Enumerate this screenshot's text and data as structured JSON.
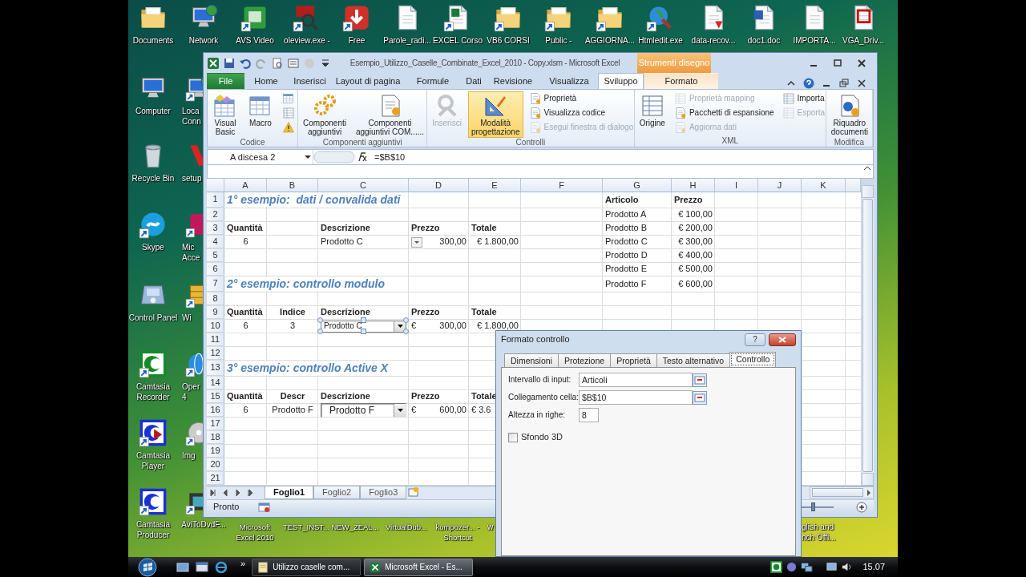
{
  "desktop": {
    "top_row": [
      {
        "label": "Documents",
        "kind": "folder",
        "shortcut": false
      },
      {
        "label": "Network",
        "kind": "network",
        "shortcut": false
      },
      {
        "label": "AVS Video",
        "kind": "video",
        "shortcut": true
      },
      {
        "label": "oleview.exe -",
        "kind": "magnifier",
        "shortcut": true
      },
      {
        "label": "Free",
        "kind": "download",
        "shortcut": true
      },
      {
        "label": "Parole_radi...",
        "kind": "document",
        "shortcut": false
      },
      {
        "label": "EXCEL Corso",
        "kind": "sheetdoc",
        "shortcut": true
      },
      {
        "label": "VB6 CORSI",
        "kind": "folder",
        "shortcut": true
      },
      {
        "label": "Public -",
        "kind": "folder",
        "shortcut": true
      },
      {
        "label": "AGGIORNA...",
        "kind": "folder",
        "shortcut": true
      },
      {
        "label": "Htmledit.exe",
        "kind": "tools",
        "shortcut": true
      },
      {
        "label": "data-recov...",
        "kind": "pdfdoc",
        "shortcut": false
      },
      {
        "label": "doc1.doc",
        "kind": "worddoc",
        "shortcut": false
      },
      {
        "label": "IMPORTA...",
        "kind": "document",
        "shortcut": false
      },
      {
        "label": "VGA_Driv...",
        "kind": "reddoc",
        "shortcut": false
      }
    ],
    "left_column": [
      {
        "label": "Computer",
        "kind": "computer",
        "shortcut": false
      },
      {
        "label": "Recycle Bin",
        "kind": "trash",
        "shortcut": false
      },
      {
        "label": "Skype",
        "kind": "chat",
        "shortcut": true
      },
      {
        "label": "Control Panel",
        "kind": "control",
        "shortcut": false
      },
      {
        "label": "Camtasia Recorder",
        "kind": "ringgreen",
        "shortcut": true
      },
      {
        "label": "Camtasia Player",
        "kind": "ringplay",
        "shortcut": true
      },
      {
        "label": "Camtasia Producer",
        "kind": "ringblue",
        "shortcut": true
      }
    ],
    "second_column": [
      {
        "label": "Loca Conn",
        "kind": "network",
        "shortcut": true
      },
      {
        "label": "setup",
        "kind": "appred",
        "shortcut": false
      },
      {
        "label": "Mic Acce",
        "kind": "apppink",
        "shortcut": true
      },
      {
        "label": "Wi",
        "kind": "cabinet",
        "shortcut": true
      },
      {
        "label": "Oper 4",
        "kind": "globe",
        "shortcut": true
      },
      {
        "label": "Img",
        "kind": "disc",
        "shortcut": true
      },
      {
        "label": "AviToDvdF...",
        "kind": "film",
        "shortcut": true
      }
    ],
    "bottom_labels": [
      "Microsoft Excel 2010",
      "TEST_INST...",
      "NEW_ZEAL...",
      "VirtualDub...",
      "kompozer... - Shortcut",
      "w",
      "glish and nch Offi..."
    ]
  },
  "excel": {
    "title": "Esempio_Utilizzo_Caselle_Combinate_Excel_2010 - Copy.xlsm - Microsoft Excel",
    "context_label": "Strumenti disegno",
    "tabs": [
      {
        "label": "File",
        "kind": "file",
        "selected": false
      },
      {
        "label": "Home",
        "kind": "tab",
        "selected": false
      },
      {
        "label": "Inserisci",
        "kind": "tab",
        "selected": false
      },
      {
        "label": "Layout di pagina",
        "kind": "tab",
        "selected": false
      },
      {
        "label": "Formule",
        "kind": "tab",
        "selected": false
      },
      {
        "label": "Dati",
        "kind": "tab",
        "selected": false
      },
      {
        "label": "Revisione",
        "kind": "tab",
        "selected": false
      },
      {
        "label": "Visualizza",
        "kind": "tab",
        "selected": false
      },
      {
        "label": "Sviluppo",
        "kind": "tab",
        "selected": true
      },
      {
        "label": "Formato",
        "kind": "context",
        "selected": false
      }
    ],
    "groups": [
      {
        "label": "Codice",
        "columns": [
          [
            {
              "label": "Visual\nBasic",
              "kind": "large",
              "disabled": false,
              "on": false
            }
          ],
          [
            {
              "label": "Macro",
              "kind": "large",
              "disabled": false,
              "on": false
            }
          ],
          [
            {
              "kind": "icon",
              "disabled": false,
              "on": false
            },
            {
              "kind": "icon",
              "disabled": false,
              "on": false
            },
            {
              "kind": "icon",
              "disabled": false,
              "on": false
            }
          ]
        ]
      },
      {
        "label": "Componenti aggiuntivi",
        "columns": [
          [
            {
              "label": "Componenti\naggiuntivi",
              "kind": "large",
              "disabled": false,
              "on": false
            }
          ],
          [
            {
              "label": "Componenti\naggiuntivi COM......",
              "kind": "large",
              "disabled": false,
              "on": false
            }
          ]
        ]
      },
      {
        "label": "Controlli",
        "columns": [
          [
            {
              "label": "Inserisci",
              "kind": "large",
              "disabled": true,
              "on": false
            }
          ],
          [
            {
              "label": "Modalità\nprogettazione",
              "kind": "large",
              "disabled": false,
              "on": true
            }
          ],
          [
            {
              "label": "Proprietà",
              "kind": "small",
              "disabled": false,
              "on": false
            },
            {
              "label": "Visualizza codice",
              "kind": "small",
              "disabled": false,
              "on": false
            },
            {
              "label": "Esegui finestra di dialogo",
              "kind": "small",
              "disabled": true,
              "on": false
            }
          ]
        ]
      },
      {
        "label": "XML",
        "columns": [
          [
            {
              "label": "Origine",
              "kind": "large",
              "disabled": false,
              "on": false
            }
          ],
          [
            {
              "label": "Proprietà mapping",
              "kind": "small",
              "disabled": true,
              "on": false
            },
            {
              "label": "Pacchetti di espansione",
              "kind": "small",
              "disabled": false,
              "on": false
            },
            {
              "label": "Aggiorna dati",
              "kind": "small",
              "disabled": true,
              "on": false
            }
          ],
          [
            {
              "label": "Importa",
              "kind": "small",
              "disabled": false,
              "on": false
            },
            {
              "label": "Esporta",
              "kind": "small",
              "disabled": true,
              "on": false
            }
          ]
        ]
      },
      {
        "label": "Modifica",
        "columns": [
          [
            {
              "label": "Riquadro\ndocumenti",
              "kind": "large",
              "disabled": false,
              "on": false
            }
          ]
        ]
      }
    ],
    "name_box": "A discesa 2",
    "formula": "=$B$10",
    "columns": [
      "A",
      "B",
      "C",
      "D",
      "E",
      "F",
      "G",
      "H",
      "I",
      "J",
      "K"
    ],
    "rows": [
      {
        "number": "1",
        "cells": [
          {
            "text": "1° esempio:  dati / convalida dati",
            "kind": "title"
          },
          {},
          {},
          {},
          {},
          {},
          {
            "text": "Articolo",
            "kind": "header"
          },
          {
            "text": "Prezzo",
            "kind": "header"
          }
        ]
      },
      {
        "number": "2",
        "cells": [
          {},
          {},
          {},
          {},
          {},
          {},
          {
            "text": "Prodotto A",
            "kind": "text"
          },
          {
            "text": "€ 100,00",
            "kind": "right"
          }
        ]
      },
      {
        "number": "3",
        "cells": [
          {
            "text": "Quantità",
            "kind": "header"
          },
          {},
          {
            "text": "Descrizione",
            "kind": "header"
          },
          {
            "text": "Prezzo",
            "kind": "header"
          },
          {
            "text": "Totale",
            "kind": "header"
          },
          {},
          {
            "text": "Prodotto B",
            "kind": "text"
          },
          {
            "text": "€ 200,00",
            "kind": "right"
          }
        ]
      },
      {
        "number": "4",
        "cells": [
          {
            "text": "6",
            "kind": "center"
          },
          {},
          {
            "text": "Prodotto C",
            "kind": "text"
          },
          {
            "text": "300,00",
            "kind": "dropdown"
          },
          {
            "text": "€ 1.800,00",
            "kind": "right"
          },
          {},
          {
            "text": "Prodotto C",
            "kind": "text"
          },
          {
            "text": "€ 300,00",
            "kind": "right"
          }
        ]
      },
      {
        "number": "5",
        "cells": [
          {},
          {},
          {},
          {},
          {},
          {},
          {
            "text": "Prodotto D",
            "kind": "text"
          },
          {
            "text": "€ 400,00",
            "kind": "right"
          }
        ]
      },
      {
        "number": "6",
        "cells": [
          {},
          {},
          {},
          {},
          {},
          {},
          {
            "text": "Prodotto E",
            "kind": "text"
          },
          {
            "text": "€ 500,00",
            "kind": "right"
          }
        ]
      },
      {
        "number": "7",
        "cells": [
          {
            "text": "2° esempio: controllo modulo",
            "kind": "title"
          },
          {},
          {},
          {},
          {},
          {},
          {
            "text": "Prodotto F",
            "kind": "text"
          },
          {
            "text": "€ 600,00",
            "kind": "right"
          }
        ]
      },
      {
        "number": "8"
      },
      {
        "number": "9",
        "cells": [
          {
            "text": "Quantità",
            "kind": "header"
          },
          {
            "text": "Indice",
            "kind": "header-center"
          },
          {
            "text": "Descrizione",
            "kind": "header"
          },
          {
            "text": "Prezzo",
            "kind": "header"
          },
          {
            "text": "Totale",
            "kind": "header"
          }
        ]
      },
      {
        "number": "10",
        "cells": [
          {
            "text": "6",
            "kind": "center"
          },
          {
            "text": "3",
            "kind": "center"
          },
          {
            "text": "Prodotto C",
            "kind": "form-combo",
            "selected": true
          },
          {
            "symbol": "€",
            "text": "300,00",
            "kind": "euro"
          },
          {
            "text": "€ 1.800,00",
            "kind": "right"
          }
        ]
      },
      {
        "number": "11"
      },
      {
        "number": "12"
      },
      {
        "number": "13",
        "cells": [
          {
            "text": "3° esempio: controllo Active X",
            "kind": "title"
          }
        ]
      },
      {
        "number": "14"
      },
      {
        "number": "15",
        "cells": [
          {
            "text": "Quantità",
            "kind": "header"
          },
          {
            "text": "Descr",
            "kind": "header-center"
          },
          {
            "text": "Descrizione",
            "kind": "header"
          },
          {
            "text": "Prezzo",
            "kind": "header"
          },
          {
            "text": "Totale",
            "kind": "header"
          }
        ]
      },
      {
        "number": "16",
        "cells": [
          {
            "text": "6",
            "kind": "center"
          },
          {
            "text": "Prodotto F",
            "kind": "center"
          },
          {
            "text": "Prodotto F",
            "kind": "activex-combo",
            "selected": false
          },
          {
            "symbol": "€",
            "text": "600,00",
            "kind": "euro"
          },
          {
            "text": "€ 3.6",
            "kind": "text"
          }
        ]
      },
      {
        "number": "17"
      },
      {
        "number": "18"
      },
      {
        "number": "19"
      },
      {
        "number": "20"
      },
      {
        "number": "21"
      }
    ],
    "sheet_tabs": [
      {
        "label": "Foglio1",
        "selected": true
      },
      {
        "label": "Foglio2",
        "selected": false
      },
      {
        "label": "Foglio3",
        "selected": false
      }
    ],
    "status": "Pronto",
    "zoom_slider": {
      "level": 0.45
    }
  },
  "dialog": {
    "title": "Formato controllo",
    "help": "?",
    "tabs": [
      {
        "label": "Dimensioni",
        "selected": false
      },
      {
        "label": "Protezione",
        "selected": false
      },
      {
        "label": "Proprietà",
        "selected": false
      },
      {
        "label": "Testo alternativo",
        "selected": false
      },
      {
        "label": "Controllo",
        "selected": true
      }
    ],
    "fields": [
      {
        "label": "Intervallo di input:",
        "value": "Articoli",
        "kind": "range"
      },
      {
        "label": "Collegamento cella:",
        "value": "$B$10",
        "kind": "range"
      },
      {
        "label": "Altezza in righe:",
        "value": "8",
        "kind": "number"
      }
    ],
    "checkbox": {
      "label": "Sfondo 3D",
      "checked": false
    }
  },
  "taskbar": {
    "more": "»",
    "tasks": [
      {
        "label": "Utilizzo caselle com...",
        "selected": false
      },
      {
        "label": "Microsoft Excel - Es...",
        "selected": true
      }
    ],
    "clock": "15.07"
  }
}
